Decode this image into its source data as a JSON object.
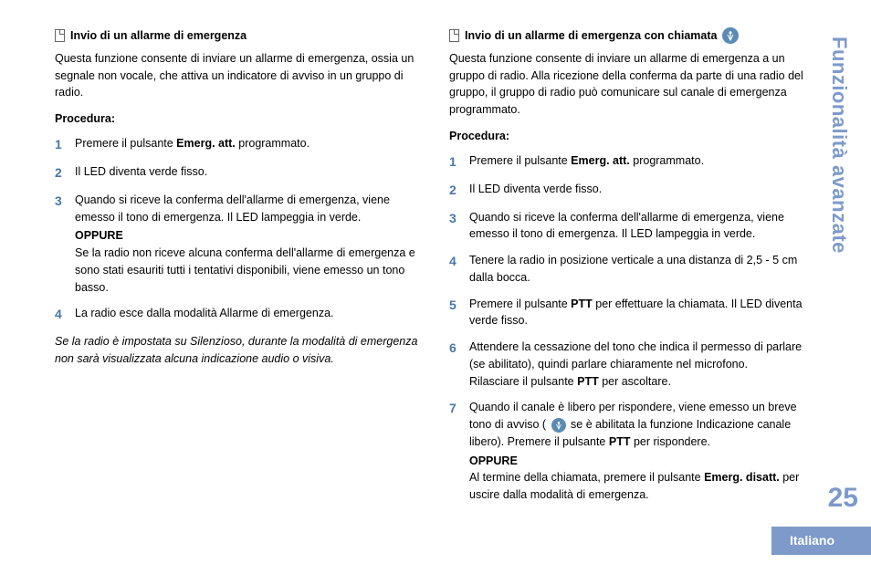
{
  "sidebar": {
    "title": "Funzionalità avanzate"
  },
  "pageNumber": "25",
  "language": "Italiano",
  "left": {
    "title": "Invio di un allarme di emergenza",
    "intro": "Questa funzione consente di inviare un allarme di emergenza, ossia un segnale non vocale, che attiva un indicatore di avviso in un gruppo di radio.",
    "procLabel": "Procedura:",
    "steps": [
      {
        "n": "1",
        "html": "Premere il pulsante <b>Emerg. att.</b> programmato."
      },
      {
        "n": "2",
        "html": "Il LED diventa verde fisso."
      },
      {
        "n": "3",
        "html": "Quando si riceve la conferma dell'allarme di emergenza, viene emesso il tono di emergenza. Il LED lampeggia in verde.<br><span class=\"oppure\">OPPURE</span>Se la radio non riceve alcuna conferma dell'allarme di emergenza e sono stati esauriti tutti i tentativi disponibili, viene emesso un tono basso."
      },
      {
        "n": "4",
        "html": "La radio esce dalla modalità Allarme di emergenza."
      }
    ],
    "note": "Se la radio è impostata su Silenzioso, durante la modalità di emergenza non sarà visualizzata alcuna indicazione audio o visiva."
  },
  "right": {
    "title": "Invio di un allarme di emergenza con chiamata",
    "intro": "Questa funzione consente di inviare un allarme di emergenza a un gruppo di radio. Alla ricezione della conferma da parte di una radio del gruppo, il gruppo di radio può comunicare sul canale di emergenza programmato.",
    "procLabel": "Procedura:",
    "steps": [
      {
        "n": "1",
        "html": "Premere il pulsante <b>Emerg. att.</b> programmato."
      },
      {
        "n": "2",
        "html": "Il LED diventa verde fisso."
      },
      {
        "n": "3",
        "html": "Quando si riceve la conferma dell'allarme di emergenza, viene emesso il tono di emergenza. Il LED lampeggia in verde."
      },
      {
        "n": "4",
        "html": "Tenere la radio in posizione verticale a una distanza di 2,5 - 5 cm dalla bocca."
      },
      {
        "n": "5",
        "html": "Premere il pulsante <b>PTT</b> per effettuare la chiamata. Il LED diventa verde fisso."
      },
      {
        "n": "6",
        "html": "Attendere la cessazione del tono che indica il permesso di parlare (se abilitato), quindi parlare chiaramente nel microfono.<br>Rilasciare il pulsante <b>PTT</b> per ascoltare."
      },
      {
        "n": "7",
        "html": "Quando il canale è libero per rispondere, viene emesso un breve tono di avviso ( <span class=\"inline-icon\" data-name=\"antenna-icon\" data-interactable=\"false\"><svg viewBox=\"0 0 10 10\"><line x1=\"5\" y1=\"1\" x2=\"5\" y2=\"9\" stroke=\"#fff\" stroke-width=\"1\"/><circle cx=\"5\" cy=\"2.5\" r=\"1.2\" fill=\"#fff\"/><path d=\"M2.5 4 L5 9 L7.5 4\" fill=\"none\" stroke=\"#fff\" stroke-width=\"0.8\"/></svg></span> se è abilitata la funzione Indicazione canale libero). Premere il pulsante <b>PTT</b> per rispondere.<br><span class=\"oppure\">OPPURE</span>Al termine della chiamata, premere il pulsante <b>Emerg. disatt.</b> per uscire dalla modalità di emergenza."
      }
    ]
  }
}
